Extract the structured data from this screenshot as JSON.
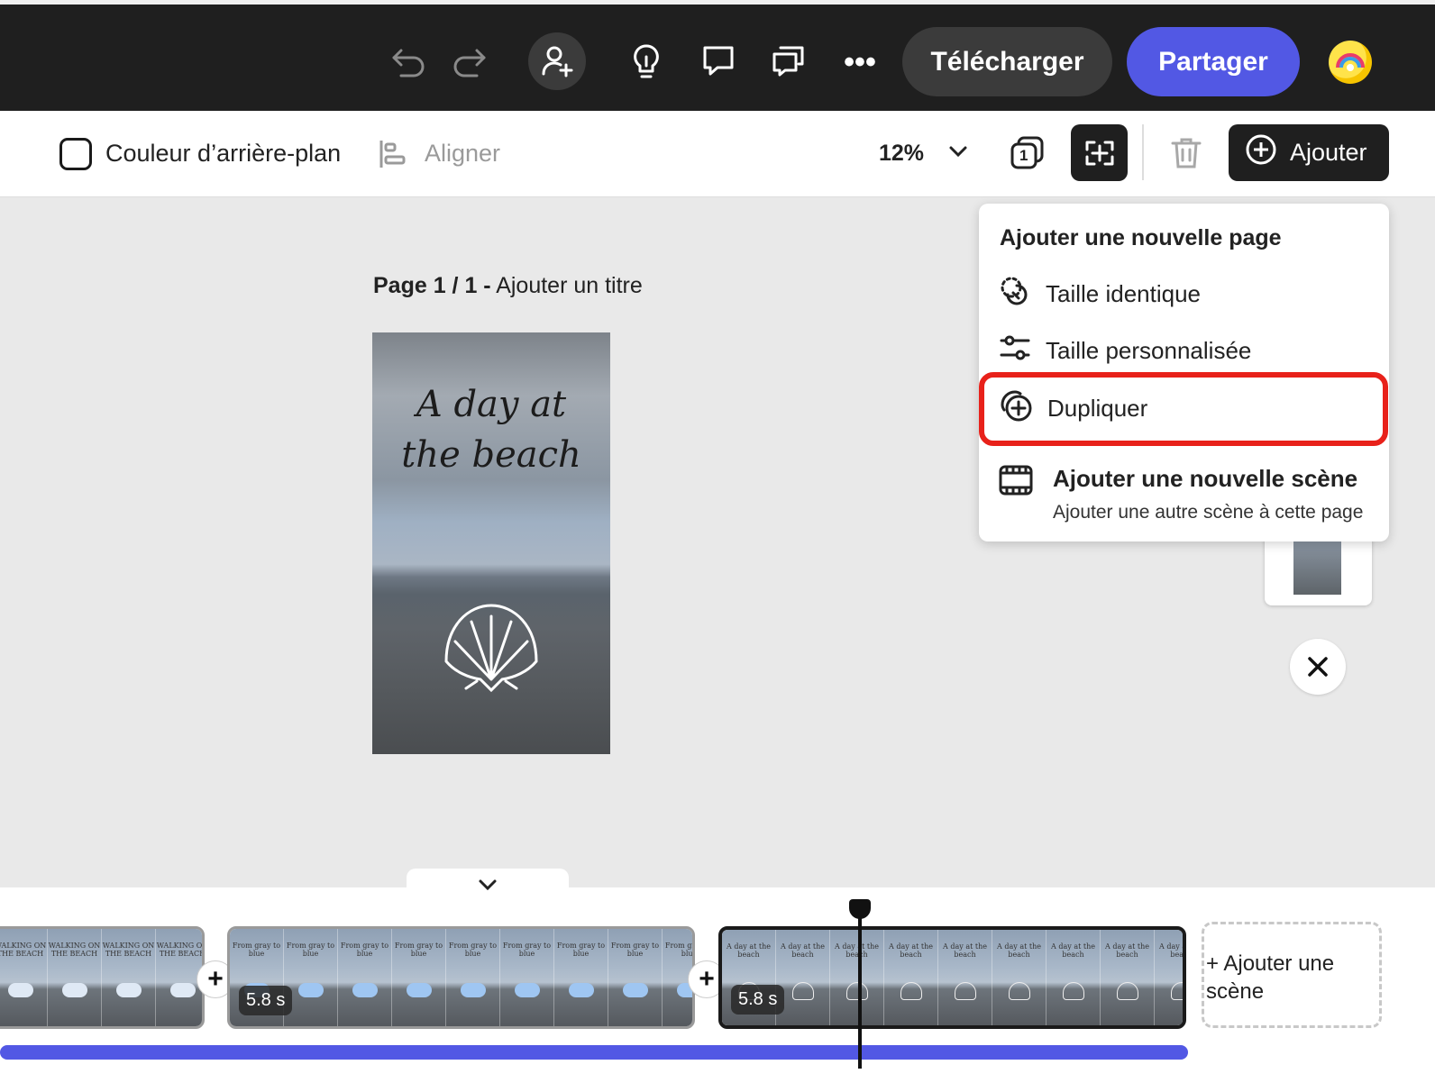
{
  "header": {
    "download_label": "Télécharger",
    "share_label": "Partager"
  },
  "toolbar": {
    "bgcolor_label": "Couleur d’arrière-plan",
    "align_label": "Aligner",
    "zoom": "12%",
    "page_count": "1",
    "add_label": "Ajouter"
  },
  "canvas": {
    "page_prefix": "Page 1 / 1 -",
    "page_title_placeholder": "Ajouter un titre",
    "design_title_line1": "A day at",
    "design_title_line2": "the beach"
  },
  "menu": {
    "title": "Ajouter une nouvelle page",
    "items": [
      {
        "label": "Taille identique",
        "icon": "same-size-icon"
      },
      {
        "label": "Taille personnalisée",
        "icon": "sliders-icon"
      },
      {
        "label": "Dupliquer",
        "icon": "duplicate-icon"
      }
    ],
    "scene_title": "Ajouter une nouvelle scène",
    "scene_subtitle": "Ajouter une autre scène à cette page"
  },
  "timeline": {
    "clips": [
      {
        "frame_text": "WALKING ON THE BEACH",
        "motif": "wave"
      },
      {
        "duration": "5.8 s",
        "frame_text": "From gray to blue",
        "motif": "cloud"
      },
      {
        "duration": "5.8 s",
        "frame_text": "A day at the beach",
        "motif": "shell"
      }
    ],
    "add_scene_label_line1": "+ Ajouter une",
    "add_scene_label_line2": "scène"
  },
  "colors": {
    "accent": "#5258e4",
    "highlight": "#e8211a",
    "topbar": "#1f1f1f"
  }
}
